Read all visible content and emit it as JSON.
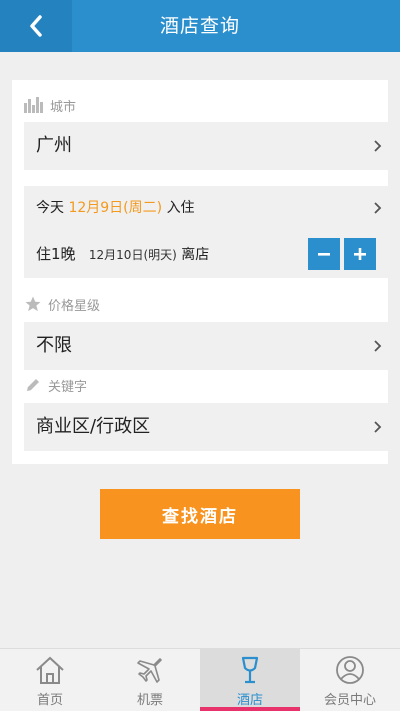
{
  "header": {
    "title": "酒店查询"
  },
  "form": {
    "city": {
      "label": "城市",
      "value": "广州"
    },
    "checkin": {
      "prefix": "今天",
      "date": "12月9日(周二)",
      "suffix": "入住"
    },
    "checkout": {
      "nights": "住1晚",
      "date": "12月10日(明天)",
      "suffix": "离店"
    },
    "stepper": {
      "minus": "−",
      "plus": "+"
    },
    "price": {
      "label": "价格星级",
      "value": "不限"
    },
    "keyword": {
      "label": "关键字",
      "value": "商业区/行政区"
    }
  },
  "search_button": {
    "label": "查找酒店"
  },
  "tabs": [
    {
      "label": "首页",
      "icon": "home-icon",
      "active": false
    },
    {
      "label": "机票",
      "icon": "airplane-icon",
      "active": false
    },
    {
      "label": "酒店",
      "icon": "wineglass-icon",
      "active": true
    },
    {
      "label": "会员中心",
      "icon": "user-icon",
      "active": false
    }
  ],
  "colors": {
    "primary": "#2b8fce",
    "accent": "#f7931e",
    "highlight": "#f39a1e",
    "tab_underline": "#e8326c"
  }
}
